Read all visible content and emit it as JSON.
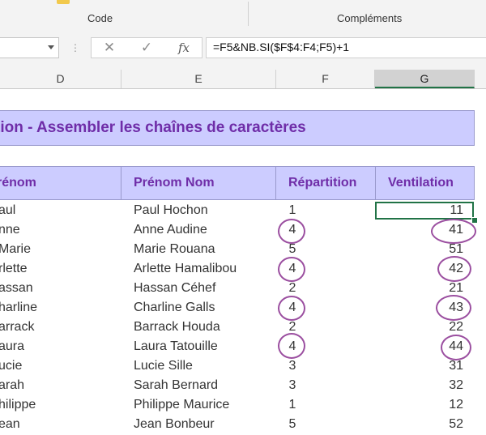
{
  "ribbon": {
    "groups": [
      {
        "label": "Code"
      },
      {
        "label": "Compléments"
      }
    ]
  },
  "formula_bar": {
    "cancel_symbol": "✕",
    "enter_symbol": "✓",
    "fx_symbol": "fx",
    "formula": "=F5&NB.SI($F$4:F4;F5)+1"
  },
  "columns": [
    "D",
    "E",
    "F",
    "G"
  ],
  "selected_column": "G",
  "sheet": {
    "title": "tion - Assembler les chaînes de caractères",
    "headers": [
      "rénom",
      "Prénom Nom",
      "Répartition",
      "Ventilation"
    ],
    "rows": [
      {
        "prenom": "aul",
        "nom": "Paul Hochon",
        "repartition": "1",
        "ventilation": "11"
      },
      {
        "prenom": "nne",
        "nom": "Anne Audine",
        "repartition": "4",
        "ventilation": "41"
      },
      {
        "prenom": "Marie",
        "nom": "Marie Rouana",
        "repartition": "5",
        "ventilation": "51"
      },
      {
        "prenom": "rlette",
        "nom": "Arlette Hamalibou",
        "repartition": "4",
        "ventilation": "42"
      },
      {
        "prenom": "assan",
        "nom": "Hassan Céhef",
        "repartition": "2",
        "ventilation": "21"
      },
      {
        "prenom": "harline",
        "nom": "Charline Galls",
        "repartition": "4",
        "ventilation": "43"
      },
      {
        "prenom": "arrack",
        "nom": "Barrack Houda",
        "repartition": "2",
        "ventilation": "22"
      },
      {
        "prenom": "aura",
        "nom": "Laura Tatouille",
        "repartition": "4",
        "ventilation": "44"
      },
      {
        "prenom": "ucie",
        "nom": "Lucie Sille",
        "repartition": "3",
        "ventilation": "31"
      },
      {
        "prenom": "arah",
        "nom": "Sarah Bernard",
        "repartition": "3",
        "ventilation": "32"
      },
      {
        "prenom": "hilippe",
        "nom": "Philippe Maurice",
        "repartition": "1",
        "ventilation": "12"
      },
      {
        "prenom": "ean",
        "nom": "Jean Bonbeur",
        "repartition": "5",
        "ventilation": "52"
      }
    ]
  },
  "colors": {
    "header_fill": "#ccccff",
    "header_text": "#6f2da8",
    "annotation_circle": "#9b4fa0",
    "selection": "#217346"
  }
}
